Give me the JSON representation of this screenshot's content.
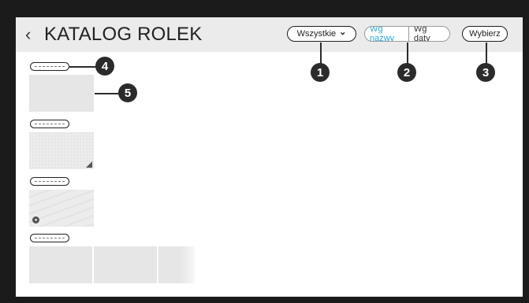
{
  "header": {
    "back_glyph": "‹",
    "title": "KATALOG ROLEK"
  },
  "controls": {
    "filter_label": "Wszystkie",
    "filter_chevron": "⌄",
    "sort_by_name": "Wg nazwy",
    "sort_by_date": "Wg daty",
    "select_label": "Wybierz"
  },
  "callouts": [
    "1",
    "2",
    "3",
    "4",
    "5"
  ],
  "groups": [
    {
      "thumbnails": 1
    },
    {
      "thumbnails": 1
    },
    {
      "thumbnails": 1
    },
    {
      "thumbnails": 3
    }
  ],
  "colors": {
    "header_bg": "#ebebeb",
    "active_sort": "#2aa7e0",
    "callout": "#2b2b2b",
    "frame": "#1b1b1b"
  },
  "icons": [
    "back-chevron-icon",
    "chevron-down-icon",
    "lock-icon",
    "corner-fold-icon"
  ]
}
